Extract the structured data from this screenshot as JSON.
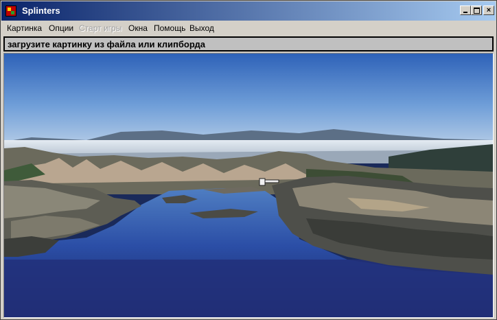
{
  "window": {
    "title": "Splinters",
    "controls": {
      "minimize": "minimize",
      "maximize": "maximize",
      "close": "×"
    }
  },
  "menu": {
    "items": [
      {
        "label": "Картинка",
        "enabled": true
      },
      {
        "label": "Опции",
        "enabled": true
      },
      {
        "label": "Старт игры",
        "enabled": false
      },
      {
        "label": "Окна",
        "enabled": true
      },
      {
        "label": "Помощь",
        "enabled": true
      },
      {
        "label": "Выход",
        "enabled": true
      }
    ]
  },
  "status": {
    "message": "загрузите картинку из файла или клипборда"
  },
  "colors": {
    "titlebar_start": "#0a246a",
    "titlebar_end": "#a6caf0",
    "window_face": "#d4d0c8",
    "status_background": "#c0c0c0"
  }
}
